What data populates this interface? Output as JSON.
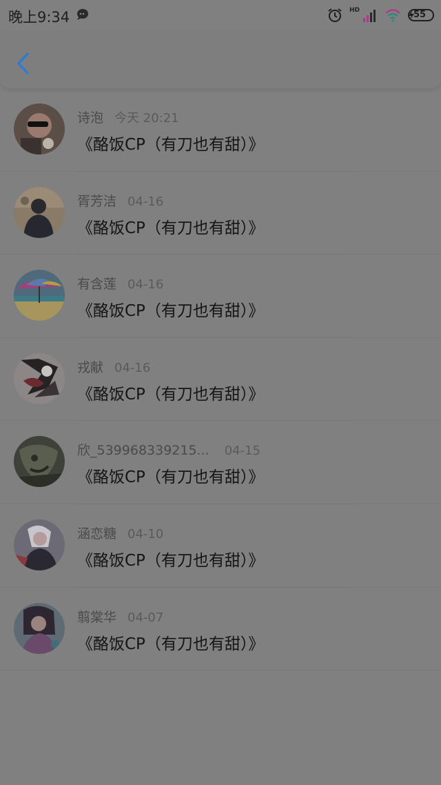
{
  "status_bar": {
    "time": "晚上9:34",
    "network_badge": "HD",
    "battery": "55",
    "icons": [
      "chat-icon",
      "alarm-icon",
      "signal-icon",
      "wifi-icon",
      "battery-icon"
    ]
  },
  "header": {
    "back_icon": "chevron-left-icon",
    "accent_color": "#2b7bd6"
  },
  "items": [
    {
      "name": "诗泡",
      "date": "今天 20:21",
      "title": "《酪饭CP（有刀也有甜）》"
    },
    {
      "name": "胥芳洁",
      "date": "04-16",
      "title": "《酪饭CP（有刀也有甜）》"
    },
    {
      "name": "有含莲",
      "date": "04-16",
      "title": "《酪饭CP（有刀也有甜）》"
    },
    {
      "name": "戎献",
      "date": "04-16",
      "title": "《酪饭CP（有刀也有甜）》"
    },
    {
      "name": "欣_539968339215...",
      "date": "04-15",
      "title": "《酪饭CP（有刀也有甜）》"
    },
    {
      "name": "涵恋糖",
      "date": "04-10",
      "title": "《酪饭CP（有刀也有甜）》"
    },
    {
      "name": "翦棠华",
      "date": "04-07",
      "title": "《酪饭CP（有刀也有甜）》"
    }
  ]
}
